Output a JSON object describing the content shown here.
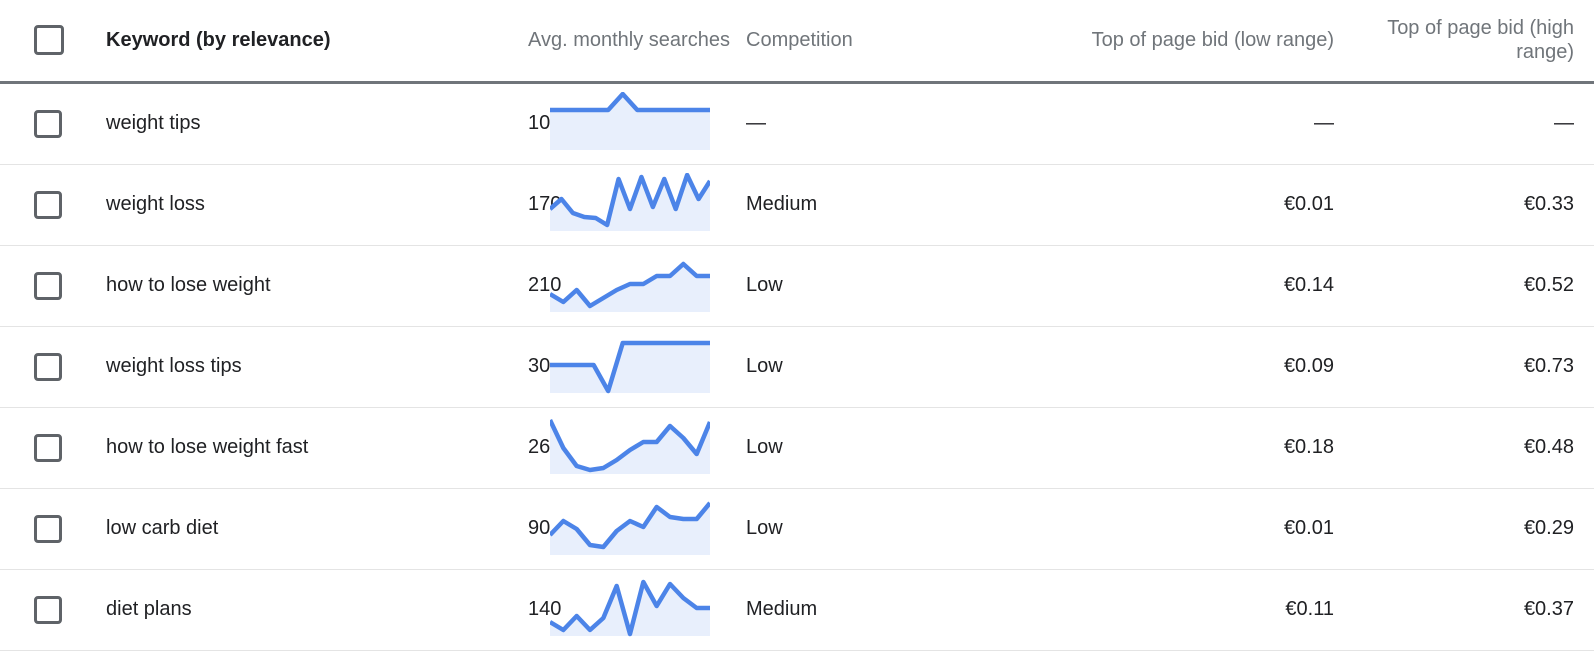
{
  "accent_color": "#4c84e8",
  "fill_color": "#e8effc",
  "checkbox_color": "#5f6368",
  "header_text_color": "#70757a",
  "row_divider_color": "#e4e4e4",
  "table": {
    "columns": {
      "select_all": "",
      "keyword": "Keyword (by relevance)",
      "avg_monthly_searches": "Avg. monthly searches",
      "competition": "Competition",
      "top_of_page_bid_low": "Top of page bid (low range)",
      "top_of_page_bid_high": "Top of page bid (high range)"
    },
    "rows": [
      {
        "selected": false,
        "keyword": "weight tips",
        "avg_monthly_searches": "10",
        "competition": "—",
        "bid_low": "—",
        "bid_high": "—",
        "trend": [
          18,
          18,
          18,
          18,
          18,
          2,
          18,
          18,
          18,
          18,
          18,
          18
        ]
      },
      {
        "selected": false,
        "keyword": "weight loss",
        "avg_monthly_searches": "170",
        "competition": "Medium",
        "bid_low": "€0.01",
        "bid_high": "€0.33",
        "trend": [
          36,
          26,
          40,
          44,
          45,
          52,
          6,
          36,
          4,
          34,
          6,
          36,
          2,
          26,
          8
        ]
      },
      {
        "selected": false,
        "keyword": "how to lose weight",
        "avg_monthly_searches": "210",
        "competition": "Low",
        "bid_low": "€0.14",
        "bid_high": "€0.52",
        "trend": [
          40,
          48,
          36,
          52,
          44,
          36,
          30,
          30,
          22,
          22,
          10,
          22,
          22
        ]
      },
      {
        "selected": false,
        "keyword": "weight loss tips",
        "avg_monthly_searches": "30",
        "competition": "Low",
        "bid_low": "€0.09",
        "bid_high": "€0.73",
        "trend": [
          30,
          30,
          30,
          30,
          56,
          8,
          8,
          8,
          8,
          8,
          8,
          8
        ]
      },
      {
        "selected": false,
        "keyword": "how to lose weight fast",
        "avg_monthly_searches": "260",
        "competition": "Low",
        "bid_low": "€0.18",
        "bid_high": "€0.48",
        "trend": [
          4,
          32,
          50,
          54,
          52,
          44,
          34,
          26,
          26,
          10,
          22,
          38,
          6
        ]
      },
      {
        "selected": false,
        "keyword": "low carb diet",
        "avg_monthly_searches": "90",
        "competition": "Low",
        "bid_low": "€0.01",
        "bid_high": "€0.29",
        "trend": [
          38,
          24,
          32,
          48,
          50,
          34,
          24,
          30,
          10,
          20,
          22,
          22,
          6
        ]
      },
      {
        "selected": false,
        "keyword": "diet plans",
        "avg_monthly_searches": "140",
        "competition": "Medium",
        "bid_low": "€0.11",
        "bid_high": "€0.37",
        "trend": [
          44,
          52,
          38,
          52,
          40,
          8,
          56,
          4,
          28,
          6,
          20,
          30,
          30
        ]
      }
    ]
  }
}
